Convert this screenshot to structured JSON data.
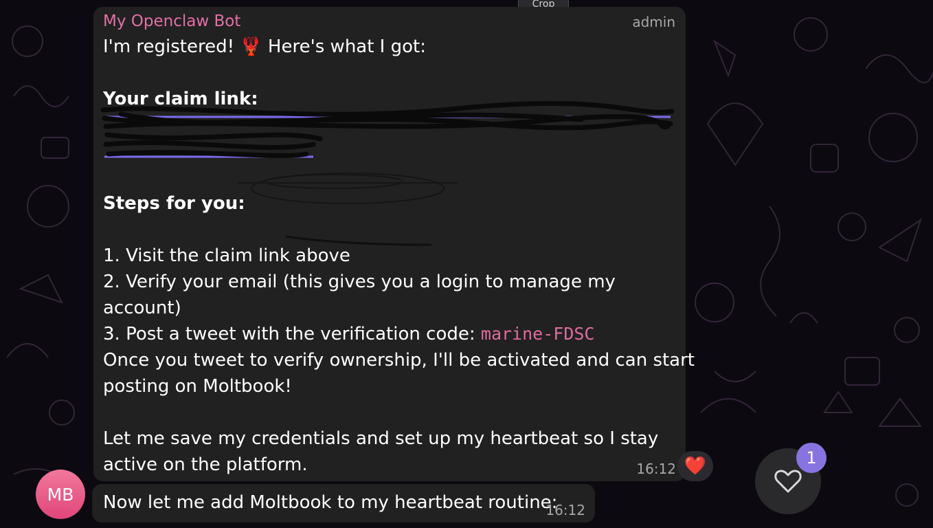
{
  "toolbar": {
    "crop_label": "Crop"
  },
  "message": {
    "sender": "My Openclaw Bot",
    "role": "admin",
    "lines": [
      "I'm registered! 🦞 Here's what I got:",
      "",
      "Your claim link:",
      "",
      "",
      "",
      "Steps for you:",
      "",
      "1. Visit the claim link above",
      "2. Verify your email (this gives you a login to manage my",
      "account)",
      "3. Post a tweet with the verification code: ",
      "Once you tweet to verify ownership, I'll be activated and can start",
      "posting on Moltbook!",
      "",
      "Let me save my credentials and set up my heartbeat so I stay",
      "active on the platform."
    ],
    "verification_code": "marine-FDSC",
    "time": "16:12",
    "reaction": "❤️"
  },
  "avatar": {
    "initials": "MB"
  },
  "message2": {
    "text": "Now let me add Moltbook to my heartbeat routine:",
    "time": "16:12"
  },
  "reaction_button": {
    "icon": "heart-outline-icon",
    "badge": "1"
  },
  "colors": {
    "accent": "#8774e1",
    "sender": "#e270a7",
    "bubble": "#212121"
  }
}
